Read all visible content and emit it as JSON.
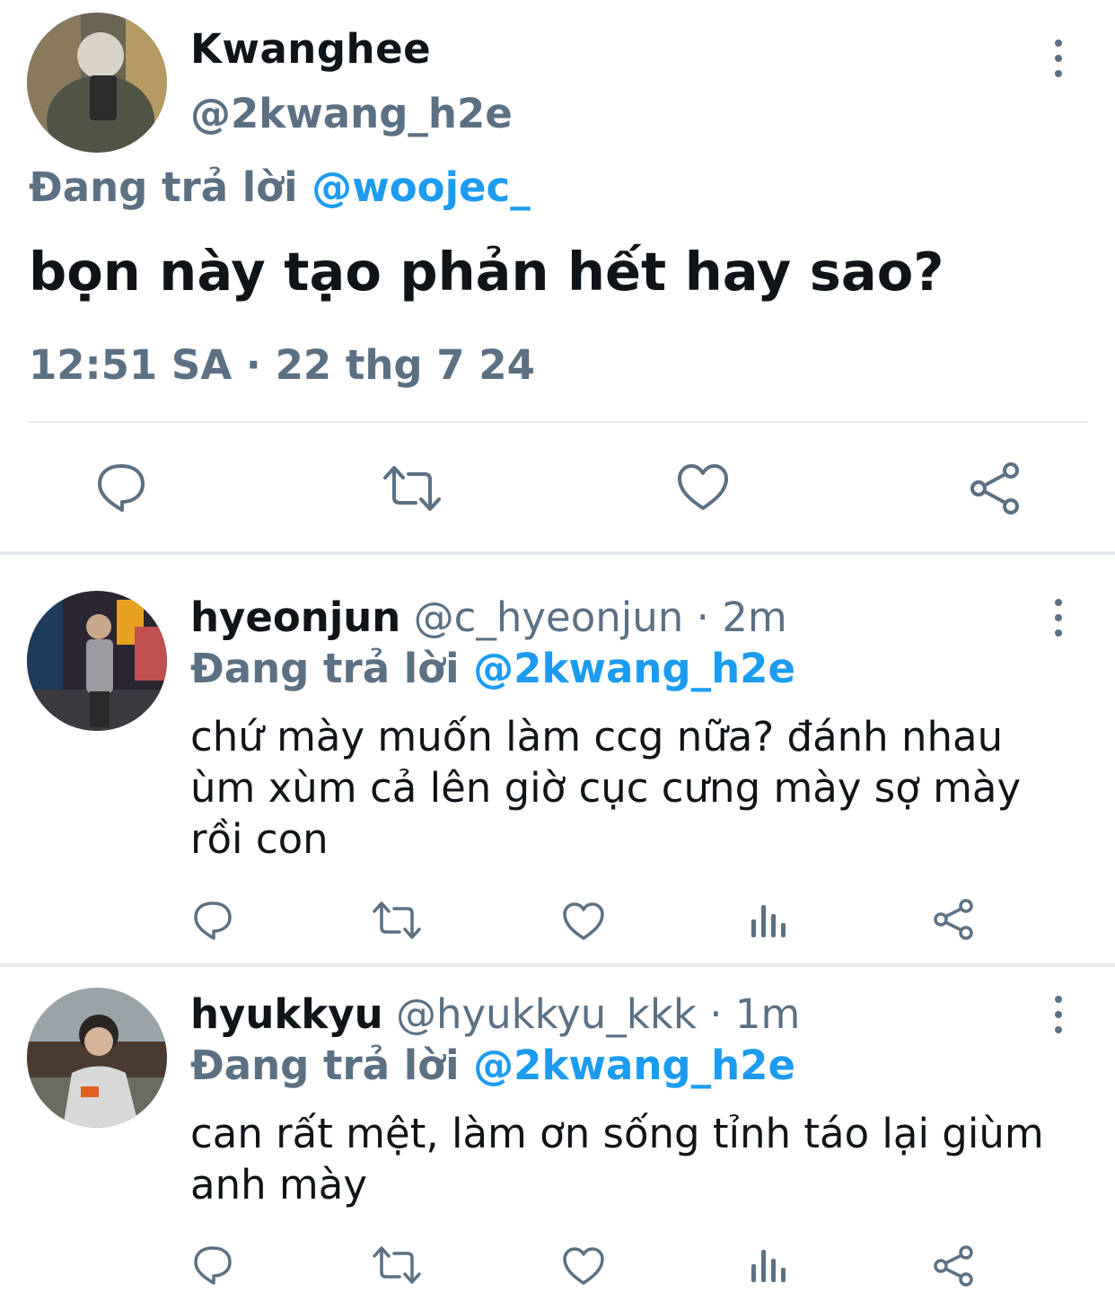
{
  "main_tweet": {
    "display_name": "Kwanghee",
    "handle": "@2kwang_h2e",
    "replying_label": "Đang trả lời",
    "replying_to": "@woojec_",
    "text": "bọn này tạo phản hết hay sao?",
    "timestamp": "12:51 SA · 22 thg 7 24",
    "actions": [
      "reply-icon",
      "retweet-icon",
      "like-icon",
      "share-icon"
    ]
  },
  "replies": [
    {
      "display_name": "hyeonjun",
      "handle": "@c_hyeonjun",
      "time": "· 2m",
      "replying_label": "Đang trả lời",
      "replying_to": "@2kwang_h2e",
      "text": "chứ mày muốn làm ccg nữa? đánh nhau\nùm xùm cả lên giờ cục cưng mày sợ mày\nrồi con",
      "actions": [
        "reply-icon",
        "retweet-icon",
        "like-icon",
        "analytics-icon",
        "share-icon"
      ]
    },
    {
      "display_name": "hyukkyu",
      "handle": "@hyukkyu_kkk",
      "time": "· 1m",
      "replying_label": "Đang trả lời",
      "replying_to": "@2kwang_h2e",
      "text": "can rất mệt, làm ơn sống tỉnh táo lại giùm\nanh mày",
      "actions": [
        "reply-icon",
        "retweet-icon",
        "like-icon",
        "analytics-icon",
        "share-icon"
      ]
    }
  ],
  "colors": {
    "text": "#0f1419",
    "secondary": "#5b7083",
    "link": "#1d9bf0",
    "divider": "#e7ebee"
  }
}
